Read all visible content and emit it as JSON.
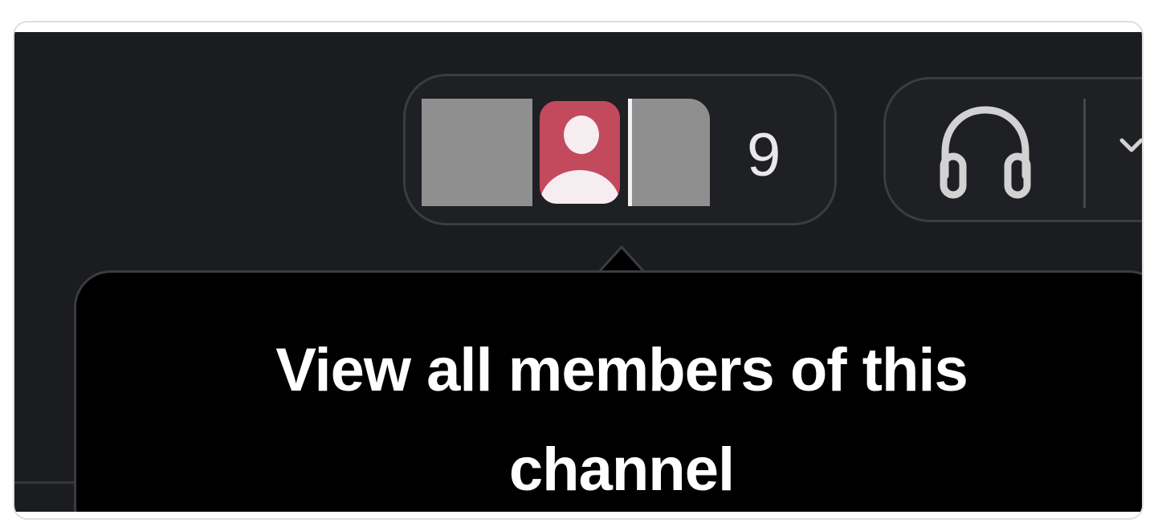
{
  "header": {
    "members": {
      "count": "9",
      "avatars": [
        {
          "kind": "redacted-avatar",
          "color": "#8f8f8f"
        },
        {
          "kind": "default-person-avatar",
          "color": "#c24a5c"
        },
        {
          "kind": "redacted-avatar",
          "color": "#8f8f8f"
        }
      ]
    },
    "huddle": {
      "icon": "headphones-icon",
      "menu_icon": "chevron-down-icon"
    }
  },
  "tooltip": {
    "text": "View all members of this channel"
  },
  "colors": {
    "background": "#1b1c1f",
    "tooltip_background": "#000000",
    "border": "#3a3c41",
    "avatar_accent": "#c24a5c",
    "text": "#ffffff"
  }
}
